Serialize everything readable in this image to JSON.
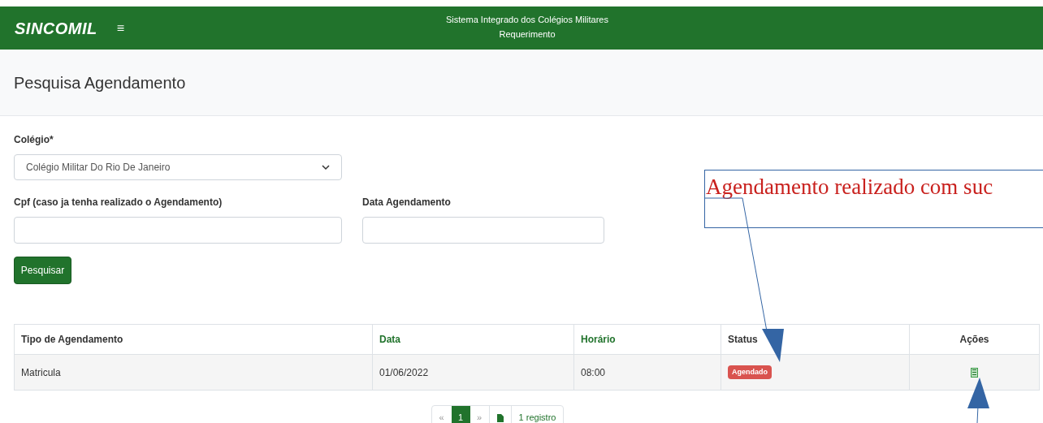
{
  "header": {
    "logo": "SINCOMIL",
    "menu_glyph": "≡",
    "title": "Sistema Integrado dos Colégios Militares",
    "subtitle": "Requerimento"
  },
  "page_title": "Pesquisa Agendamento",
  "form": {
    "colegio": {
      "label": "Colégio*",
      "value": "Colégio Militar Do Rio De Janeiro"
    },
    "cpf": {
      "label": "Cpf (caso ja tenha realizado o Agendamento)"
    },
    "data": {
      "label": "Data Agendamento"
    },
    "button": "Pesquisar"
  },
  "table": {
    "columns": [
      {
        "label": "Tipo de Agendamento",
        "sortable": false
      },
      {
        "label": "Data",
        "sortable": true
      },
      {
        "label": "Horário",
        "sortable": true
      },
      {
        "label": "Status",
        "sortable": false
      },
      {
        "label": "Ações",
        "sortable": false
      }
    ],
    "rows": [
      {
        "tipo": "Matricula",
        "data": "01/06/2022",
        "horario": "08:00",
        "status": "Agendado"
      }
    ]
  },
  "pagination": {
    "prev": "«",
    "pages": [
      {
        "label": "1",
        "selected": true
      }
    ],
    "next": "»",
    "count": "1 registro"
  },
  "annotation": {
    "text": "Agendamento realizado com suc"
  }
}
